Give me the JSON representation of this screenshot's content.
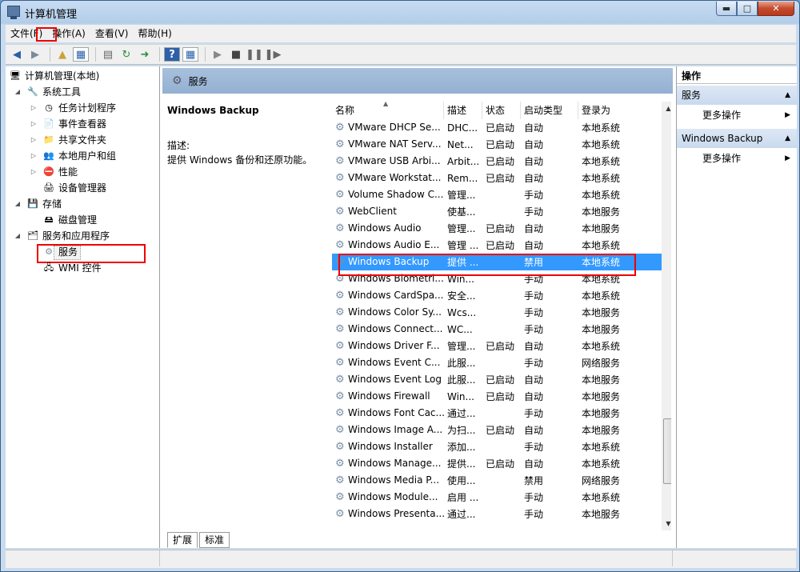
{
  "window": {
    "title": "计算机管理"
  },
  "menu": [
    {
      "label": "文件(F)"
    },
    {
      "label": "操作(A)"
    },
    {
      "label": "查看(V)"
    },
    {
      "label": "帮助(H)"
    }
  ],
  "tree": {
    "root": "计算机管理(本地)",
    "system_tools": "系统工具",
    "task_scheduler": "任务计划程序",
    "event_viewer": "事件查看器",
    "shared_folders": "共享文件夹",
    "local_users": "本地用户和组",
    "performance": "性能",
    "device_manager": "设备管理器",
    "storage": "存储",
    "disk_management": "磁盘管理",
    "services_apps": "服务和应用程序",
    "services": "服务",
    "wmi": "WMI 控件"
  },
  "center": {
    "header": "服务",
    "desc_title": "Windows Backup",
    "desc_label": "描述:",
    "desc_text": "提供 Windows 备份和还原功能。",
    "tabs": [
      "扩展",
      "标准"
    ]
  },
  "list": {
    "columns": [
      "名称",
      "描述",
      "状态",
      "启动类型",
      "登录为"
    ],
    "rows": [
      [
        "VMware DHCP Se...",
        "DHC...",
        "已启动",
        "自动",
        "本地系统"
      ],
      [
        "VMware NAT Serv...",
        "Net...",
        "已启动",
        "自动",
        "本地系统"
      ],
      [
        "VMware USB Arbi...",
        "Arbit...",
        "已启动",
        "自动",
        "本地系统"
      ],
      [
        "VMware Workstat...",
        "Rem...",
        "已启动",
        "自动",
        "本地系统"
      ],
      [
        "Volume Shadow C...",
        "管理...",
        "",
        "手动",
        "本地系统"
      ],
      [
        "WebClient",
        "使基...",
        "",
        "手动",
        "本地服务"
      ],
      [
        "Windows Audio",
        "管理...",
        "已启动",
        "自动",
        "本地服务"
      ],
      [
        "Windows Audio E...",
        "管理 ...",
        "已启动",
        "自动",
        "本地系统"
      ],
      [
        "Windows Backup",
        "提供 ...",
        "",
        "禁用",
        "本地系统"
      ],
      [
        "Windows Biometri...",
        "Win...",
        "",
        "手动",
        "本地系统"
      ],
      [
        "Windows CardSpa...",
        "安全...",
        "",
        "手动",
        "本地系统"
      ],
      [
        "Windows Color Sy...",
        "Wcs...",
        "",
        "手动",
        "本地服务"
      ],
      [
        "Windows Connect...",
        "WC...",
        "",
        "手动",
        "本地服务"
      ],
      [
        "Windows Driver F...",
        "管理...",
        "已启动",
        "自动",
        "本地系统"
      ],
      [
        "Windows Event C...",
        "此服...",
        "",
        "手动",
        "网络服务"
      ],
      [
        "Windows Event Log",
        "此服...",
        "已启动",
        "自动",
        "本地服务"
      ],
      [
        "Windows Firewall",
        "Win...",
        "已启动",
        "自动",
        "本地服务"
      ],
      [
        "Windows Font Cac...",
        "通过...",
        "",
        "手动",
        "本地服务"
      ],
      [
        "Windows Image A...",
        "为扫...",
        "已启动",
        "自动",
        "本地服务"
      ],
      [
        "Windows Installer",
        "添加...",
        "",
        "手动",
        "本地系统"
      ],
      [
        "Windows Manage...",
        "提供...",
        "已启动",
        "自动",
        "本地系统"
      ],
      [
        "Windows Media P...",
        "使用...",
        "",
        "禁用",
        "网络服务"
      ],
      [
        "Windows Module...",
        "启用 ...",
        "",
        "手动",
        "本地系统"
      ],
      [
        "Windows Presenta...",
        "通过...",
        "",
        "手动",
        "本地服务"
      ]
    ]
  },
  "right": {
    "head": "操作",
    "section1": "服务",
    "more1": "更多操作",
    "section2": "Windows Backup",
    "more2": "更多操作"
  }
}
